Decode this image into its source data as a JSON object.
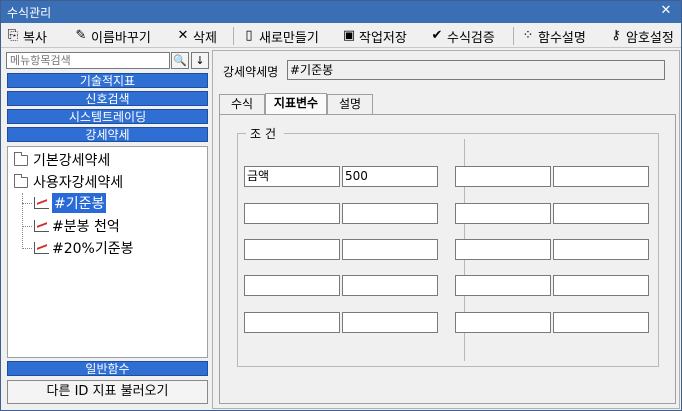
{
  "window": {
    "title": "수식관리",
    "close_symbol": "✕"
  },
  "toolbar": {
    "items": [
      {
        "label": "복사",
        "icon": "copy-icon",
        "glyph": "⎘"
      },
      {
        "label": "이름바꾸기",
        "icon": "rename-icon",
        "glyph": "✎"
      },
      {
        "label": "삭제",
        "icon": "delete-icon",
        "glyph": "✕"
      },
      {
        "label": "새로만들기",
        "icon": "new-document-icon",
        "glyph": "▯"
      },
      {
        "label": "작업저장",
        "icon": "save-icon",
        "glyph": "▣"
      },
      {
        "label": "수식검증",
        "icon": "check-icon",
        "glyph": "✔"
      },
      {
        "label": "함수설명",
        "icon": "wand-icon",
        "glyph": "⁘"
      },
      {
        "label": "암호설정",
        "icon": "key-icon",
        "glyph": "⚷"
      }
    ]
  },
  "left": {
    "search_placeholder": "메뉴항목검색",
    "search_button_glyph": "🔍",
    "down_button_glyph": "↓",
    "categories": [
      "기술적지표",
      "신호검색",
      "시스템트레이딩",
      "강세약세"
    ],
    "tree": {
      "folders": [
        "기본강세약세",
        "사용자강세약세"
      ],
      "items": [
        "#기준봉",
        "#분봉 천억",
        "#20%기준봉"
      ]
    },
    "bottom_category": "일반함수",
    "load_button": "다른 ID 지표 불러오기"
  },
  "right": {
    "name_label": "강세약세명",
    "name_value": "#기준봉",
    "tabs": [
      "수식",
      "지표변수",
      "설명"
    ],
    "active_tab": "지표변수",
    "group_title": "조건",
    "cells": {
      "r0c0": "금액",
      "r0c1": "500"
    }
  },
  "colors": {
    "titlebar": "#3a6fb6",
    "category": "#2f6fd4",
    "selected": "#2a6ad8"
  }
}
